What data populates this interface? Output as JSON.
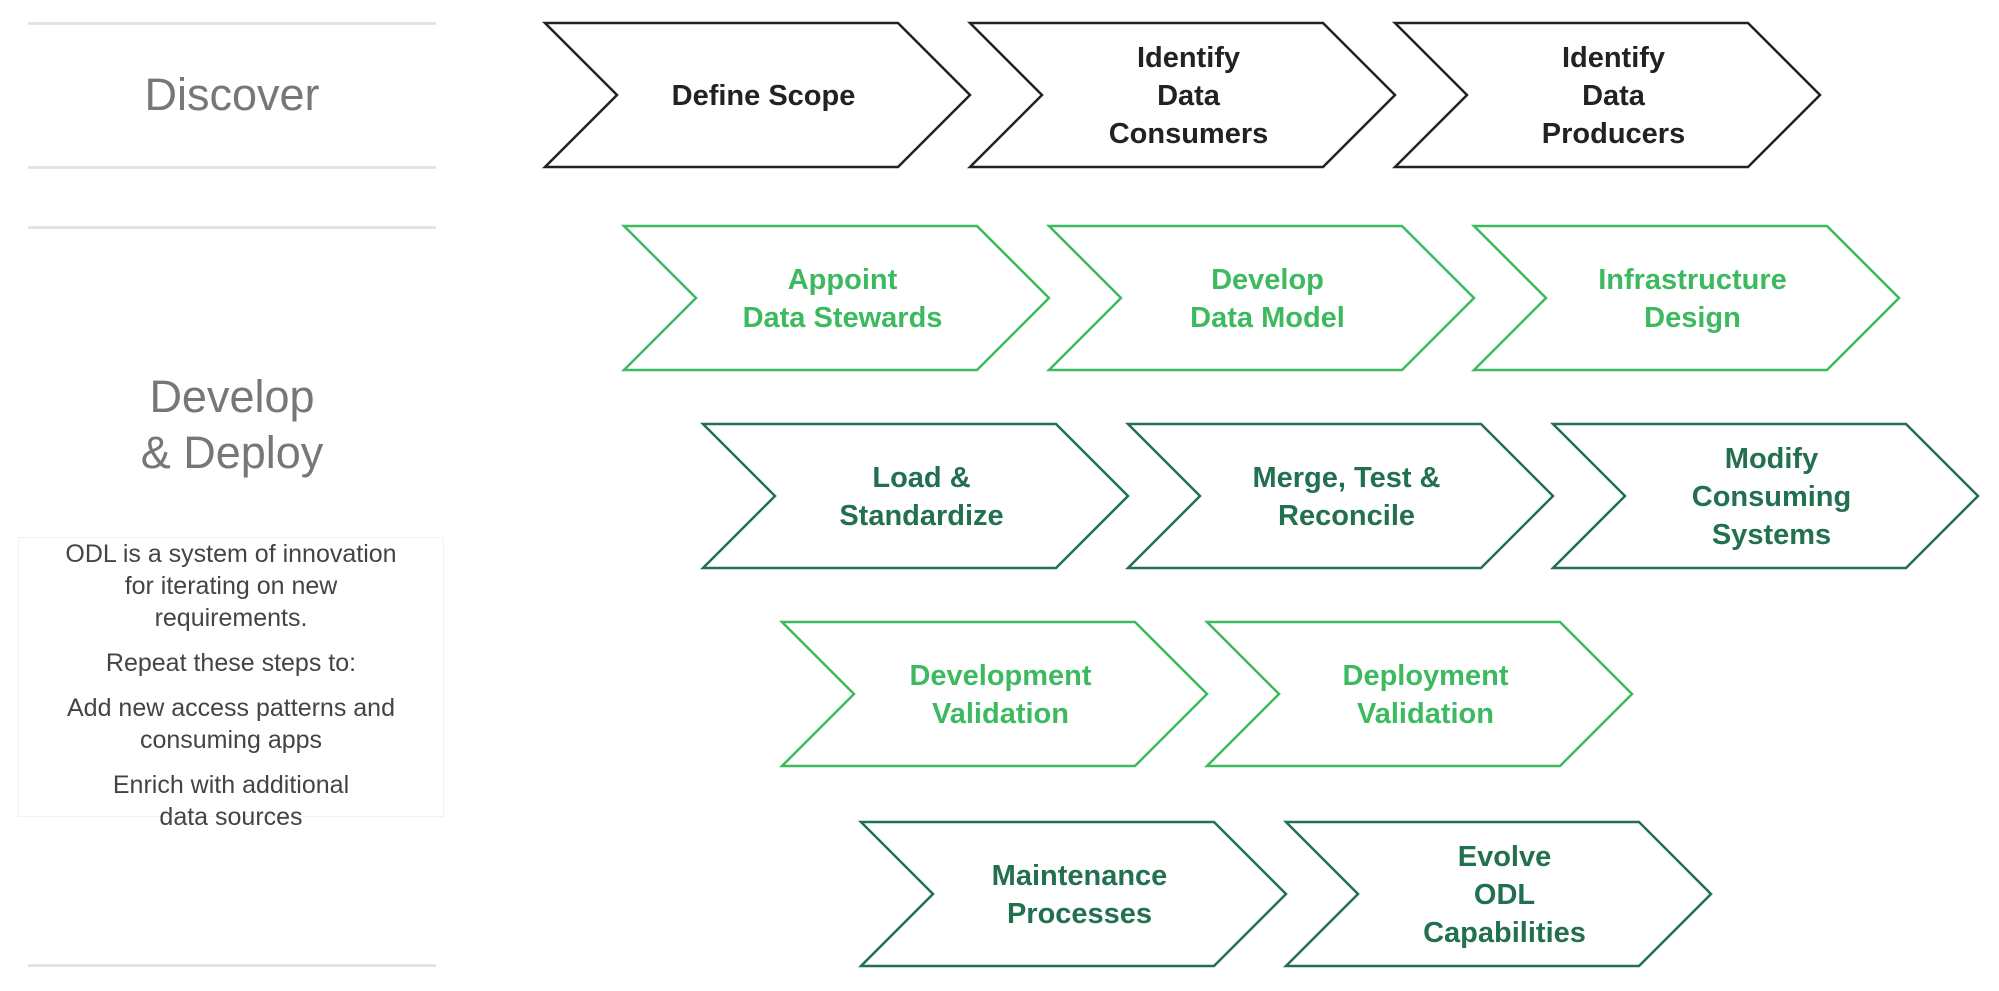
{
  "phases": {
    "discover": {
      "title": "Discover"
    },
    "develop": {
      "title_line1": "Develop",
      "title_line2": "& Deploy"
    }
  },
  "description": {
    "paragraphs": [
      [
        "ODL is a system of innovation",
        "for iterating on new",
        "requirements."
      ],
      [
        "Repeat these steps to:"
      ],
      [
        "Add new access patterns and",
        "consuming apps"
      ],
      [
        "Enrich with additional",
        "data sources"
      ]
    ]
  },
  "colors": {
    "black": "#222222",
    "light_green": "#3dba5f",
    "dark_green": "#237050",
    "phase_text": "#777777",
    "rule": "#e4e4e4"
  },
  "steps": [
    {
      "row": 0,
      "col": 0,
      "style": "black",
      "lines": [
        "Define Scope"
      ]
    },
    {
      "row": 0,
      "col": 1,
      "style": "black",
      "lines": [
        "Identify",
        "Data",
        "Consumers"
      ]
    },
    {
      "row": 0,
      "col": 2,
      "style": "black",
      "lines": [
        "Identify",
        "Data",
        "Producers"
      ]
    },
    {
      "row": 1,
      "col": 0,
      "style": "light_green",
      "lines": [
        "Appoint",
        "Data Stewards"
      ]
    },
    {
      "row": 1,
      "col": 1,
      "style": "light_green",
      "lines": [
        "Develop",
        "Data Model"
      ]
    },
    {
      "row": 1,
      "col": 2,
      "style": "light_green",
      "lines": [
        "Infrastructure",
        "Design"
      ]
    },
    {
      "row": 2,
      "col": 0,
      "style": "dark_green",
      "lines": [
        "Load &",
        "Standardize"
      ]
    },
    {
      "row": 2,
      "col": 1,
      "style": "dark_green",
      "lines": [
        "Merge, Test &",
        "Reconcile"
      ]
    },
    {
      "row": 2,
      "col": 2,
      "style": "dark_green",
      "lines": [
        "Modify",
        "Consuming",
        "Systems"
      ]
    },
    {
      "row": 3,
      "col": 0,
      "style": "light_green",
      "lines": [
        "Development",
        "Validation"
      ]
    },
    {
      "row": 3,
      "col": 1,
      "style": "light_green",
      "lines": [
        "Deployment",
        "Validation"
      ]
    },
    {
      "row": 4,
      "col": 0,
      "style": "dark_green",
      "lines": [
        "Maintenance",
        "Processes"
      ]
    },
    {
      "row": 4,
      "col": 1,
      "style": "dark_green",
      "lines": [
        "Evolve",
        "ODL",
        "Capabilities"
      ]
    }
  ]
}
